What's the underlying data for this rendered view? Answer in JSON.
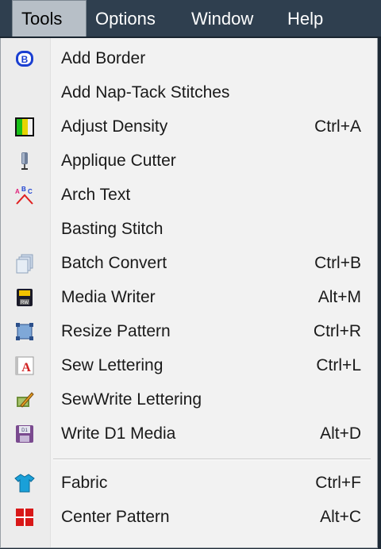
{
  "menubar": {
    "items": [
      {
        "label": "Tools"
      },
      {
        "label": "Options"
      },
      {
        "label": "Window"
      },
      {
        "label": "Help"
      }
    ]
  },
  "dropdown": {
    "items": [
      {
        "label": "Add Border",
        "shortcut": "",
        "icon": "border-b-icon"
      },
      {
        "label": "Add Nap-Tack Stitches",
        "shortcut": "",
        "icon": ""
      },
      {
        "label": "Adjust Density",
        "shortcut": "Ctrl+A",
        "icon": "density-icon"
      },
      {
        "label": "Applique Cutter",
        "shortcut": "",
        "icon": "cutter-icon"
      },
      {
        "label": "Arch Text",
        "shortcut": "",
        "icon": "arch-text-icon"
      },
      {
        "label": "Basting Stitch",
        "shortcut": "",
        "icon": ""
      },
      {
        "label": "Batch Convert",
        "shortcut": "Ctrl+B",
        "icon": "batch-convert-icon"
      },
      {
        "label": "Media Writer",
        "shortcut": "Alt+M",
        "icon": "media-writer-icon"
      },
      {
        "label": "Resize Pattern",
        "shortcut": "Ctrl+R",
        "icon": "resize-icon"
      },
      {
        "label": "Sew Lettering",
        "shortcut": "Ctrl+L",
        "icon": "sew-lettering-icon"
      },
      {
        "label": "SewWrite Lettering",
        "shortcut": "",
        "icon": "sewwrite-icon"
      },
      {
        "label": "Write D1 Media",
        "shortcut": "Alt+D",
        "icon": "floppy-d1-icon"
      },
      {
        "label": "Fabric",
        "shortcut": "Ctrl+F",
        "icon": "fabric-shirt-icon"
      },
      {
        "label": "Center Pattern",
        "shortcut": "Alt+C",
        "icon": "center-pattern-icon"
      }
    ]
  }
}
